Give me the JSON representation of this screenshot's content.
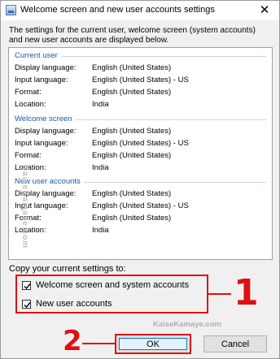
{
  "window": {
    "title": "Welcome screen and new user accounts settings",
    "close_glyph": "✕"
  },
  "description": "The settings for the current user, welcome screen (system accounts) and new user accounts are displayed below.",
  "groups": [
    {
      "title": "Current user",
      "rows": [
        {
          "label": "Display language:",
          "value": "English (United States)"
        },
        {
          "label": "Input language:",
          "value": "English (United States) - US"
        },
        {
          "label": "Format:",
          "value": "English (United States)"
        },
        {
          "label": "Location:",
          "value": "India"
        }
      ]
    },
    {
      "title": "Welcome screen",
      "rows": [
        {
          "label": "Display language:",
          "value": "English (United States)"
        },
        {
          "label": "Input language:",
          "value": "English (United States) - US"
        },
        {
          "label": "Format:",
          "value": "English (United States)"
        },
        {
          "label": "Location:",
          "value": "India"
        }
      ]
    },
    {
      "title": "New user accounts",
      "rows": [
        {
          "label": "Display language:",
          "value": "English (United States)"
        },
        {
          "label": "Input language:",
          "value": "English (United States) - US"
        },
        {
          "label": "Format:",
          "value": "English (United States)"
        },
        {
          "label": "Location:",
          "value": "India"
        }
      ]
    }
  ],
  "copy_settings": {
    "label": "Copy your current settings to:",
    "options": [
      {
        "label": "Welcome screen and system accounts",
        "checked": true
      },
      {
        "label": "New user accounts",
        "checked": true
      }
    ]
  },
  "buttons": {
    "ok": "OK",
    "cancel": "Cancel"
  },
  "annotations": {
    "callout_1": "1",
    "callout_2": "2",
    "watermark": "KaiseKamaye.com",
    "accent_color": "#e01010"
  }
}
